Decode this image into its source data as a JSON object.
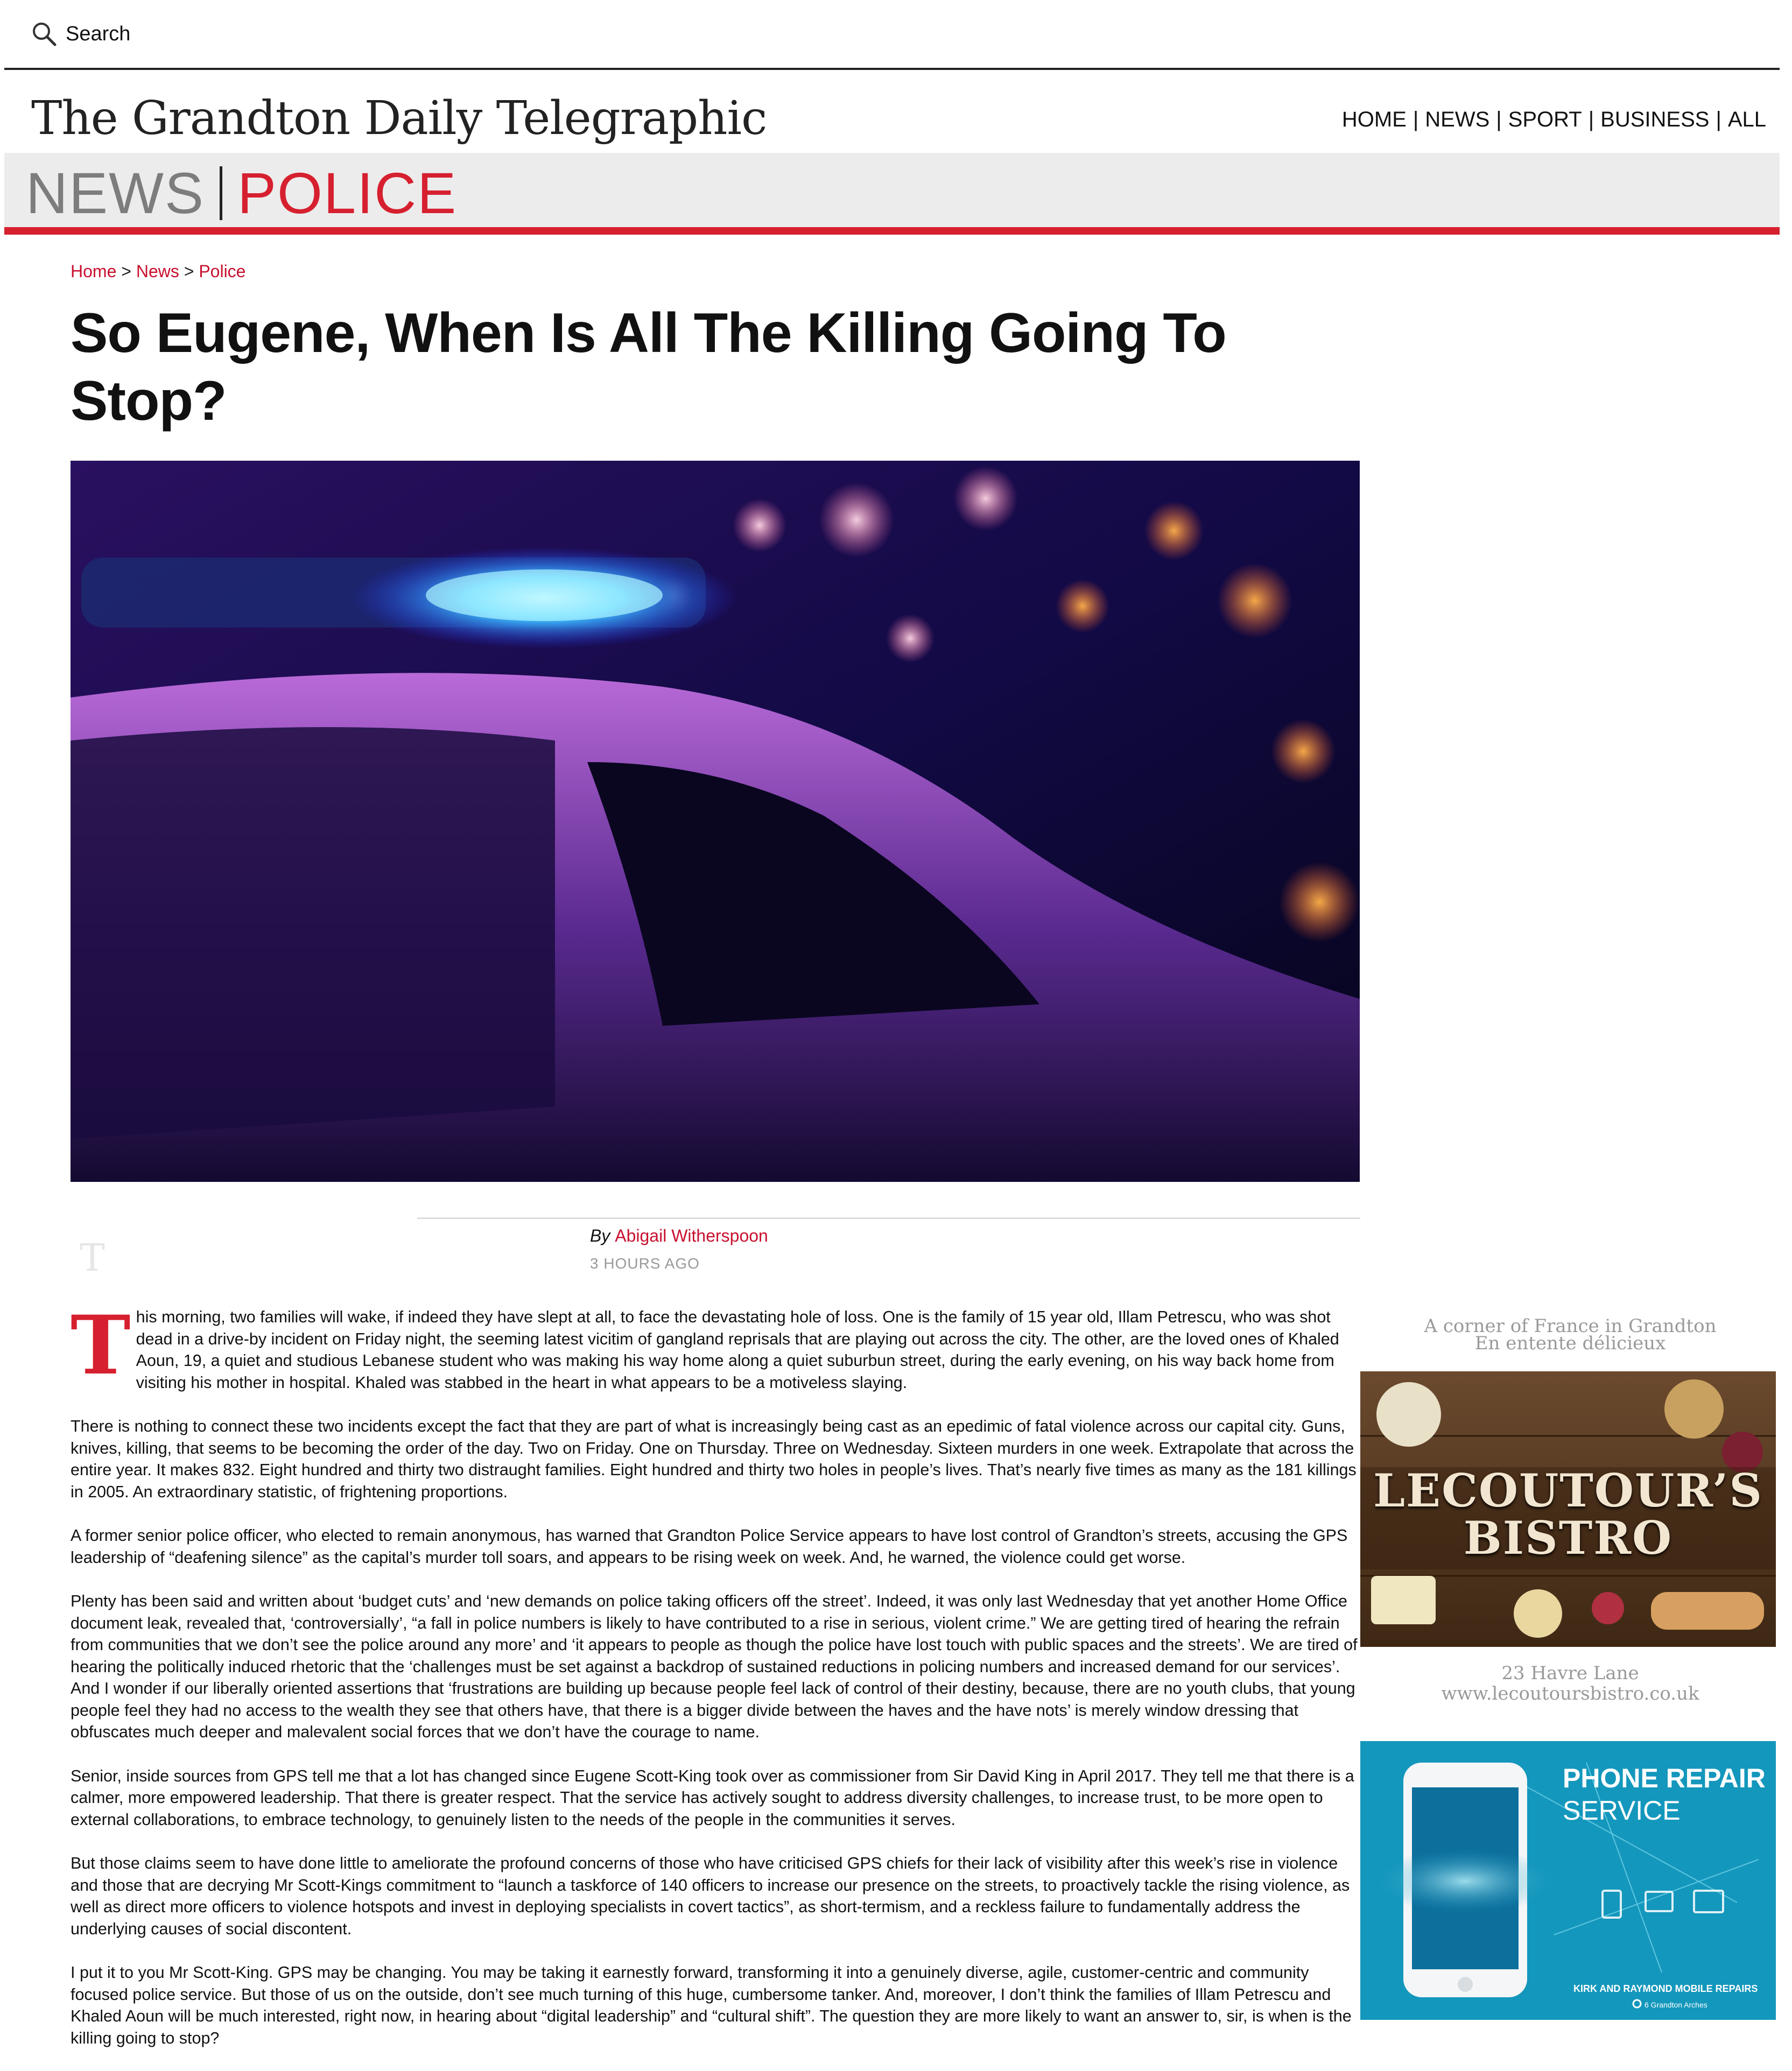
{
  "search": {
    "label": "Search"
  },
  "masthead": {
    "title": "The Grandton Daily Telegraphic"
  },
  "nav": {
    "items": [
      "HOME",
      "NEWS",
      "SPORT",
      "BUSINESS",
      "ALL"
    ],
    "separator": "|"
  },
  "section": {
    "primary": "NEWS",
    "secondary": "POLICE"
  },
  "breadcrumb": {
    "home": "Home",
    "news": "News",
    "police": "Police",
    "sep": ">"
  },
  "article": {
    "headline": "So Eugene, When Is All The Killing Going To Stop?",
    "byline_prefix": "By",
    "author": "Abigail Witherspoon",
    "time_ago": "3 HOURS AGO",
    "ghost_initial": "T",
    "drop_cap": "T",
    "p1_rest": "his morning, two families will wake, if indeed they have slept at all, to face the devastating hole of loss. One is the family of 15 year old, Illam Petrescu, who was shot dead in a drive-by incident on Friday night, the seeming latest vicitim of gangland reprisals that are playing out across the city. The other, are the loved ones of Khaled Aoun, 19, a quiet and studious Lebanese student who was making his way home along a quiet suburbun street, during the early evening, on his way back home from visiting his mother in hospital. Khaled was stabbed in the heart in what appears to be a motiveless slaying.",
    "paragraphs": [
      "There is nothing to connect these two incidents except the fact that they are part of what is increasingly being cast as an epedimic of fatal violence across our capital city. Guns, knives, killing, that seems to be becoming the order of the day. Two on Friday. One on Thursday. Three on Wednesday. Sixteen murders in one week. Extrapolate that across the entire year. It makes 832. Eight hundred and thirty two distraught families. Eight hundred and thirty two holes in people’s lives. That’s nearly five times as many as the 181 killings in 2005. An extraordinary statistic, of frightening proportions.",
      "A former senior police officer, who elected to remain anonymous, has warned that Grandton Police Service appears to have lost control of Grandton’s streets, accusing the GPS leadership of “deafening silence” as the capital’s murder toll soars, and appears to be rising week on week. And, he warned, the violence could get worse.",
      "Plenty has been said and written about ‘budget cuts’ and ‘new demands on police taking officers off the street’. Indeed, it was only last Wednesday that yet another Home Office document leak, revealed that, ‘controversially’, “a fall in police numbers is likely to have contributed to a rise in serious, violent crime.” We are getting tired of hearing the refrain from communities that we don’t see the police around any more’ and ‘it appears to people as though the police have lost touch with public spaces and the streets’. We are tired of hearing the politically induced rhetoric that the ‘challenges must be set against a backdrop of sustained reductions in policing numbers and increased demand for our services’. And I wonder if our liberally oriented assertions that ‘frustrations are building up because people feel lack of control of their destiny, because, there are no youth clubs, that young people feel they had no access to the wealth they see that others have, that there is a bigger divide between the haves and the have nots’ is merely window dressing that obfuscates much deeper and malevalent social forces that we don’t have the courage to name.",
      "Senior, inside sources from GPS tell me that a lot has changed since Eugene Scott-King took over as commissioner from Sir David King in April 2017. They tell me that there is a calmer, more empowered leadership. That there is greater respect. That the service has actively sought to address diversity challenges, to increase trust, to be more open to external collaborations, to embrace technology, to genuinely listen to the needs of the people in the communities it serves.",
      "But those claims seem to have done little to ameliorate the profound concerns of those who have criticised GPS chiefs for their lack of visibility after this week’s rise in violence and those that are decrying Mr Scott-Kings commitment to “launch a taskforce of 140 officers to increase our presence on the streets, to proactively tackle the rising violence, as well as direct more officers to violence hotspots and invest in deploying specialists in covert tactics”, as short-termism, and a reckless failure to fundamentally address the underlying causes of social discontent.",
      "I put it to you Mr Scott-King. GPS may be changing. You may be taking it earnestly forward, transforming it into a genuinely diverse, agile, customer-centric and community focused police service. But those of us on the outside, don’t see much turning of this huge, cumbersome tanker. And, moreover, I don’t think the families of Illam Petrescu and Khaled Aoun will be much interested, right now, in hearing about “digital leadership” and “cultural shift”. The question they are more likely to want an answer to, sir, is when is the killing going to stop?"
    ]
  },
  "ad_bistro": {
    "tagline1": "A corner of  France in Grandton",
    "tagline2": "En entente délicieux",
    "sign1": "LECOUTOUR’S",
    "sign2": "BISTRO",
    "address": "23 Havre Lane",
    "url": "www.lecoutoursbistro.co.uk"
  },
  "ad_phone": {
    "title1": "PHONE REPAIR",
    "title2": "SERVICE",
    "company": "KIRK AND RAYMOND MOBILE REPAIRS",
    "location": "6 Grandton Arches"
  },
  "colors": {
    "accent_red": "#d6202f",
    "link_red": "#c8102e",
    "band_gray": "#ececec",
    "ad_blue": "#1497bc"
  },
  "icons": {
    "search": "search-icon",
    "pin": "location-pin-icon",
    "phone": "phone-icon",
    "laptop": "laptop-icon",
    "monitor": "monitor-icon",
    "tablet": "tablet-icon"
  }
}
